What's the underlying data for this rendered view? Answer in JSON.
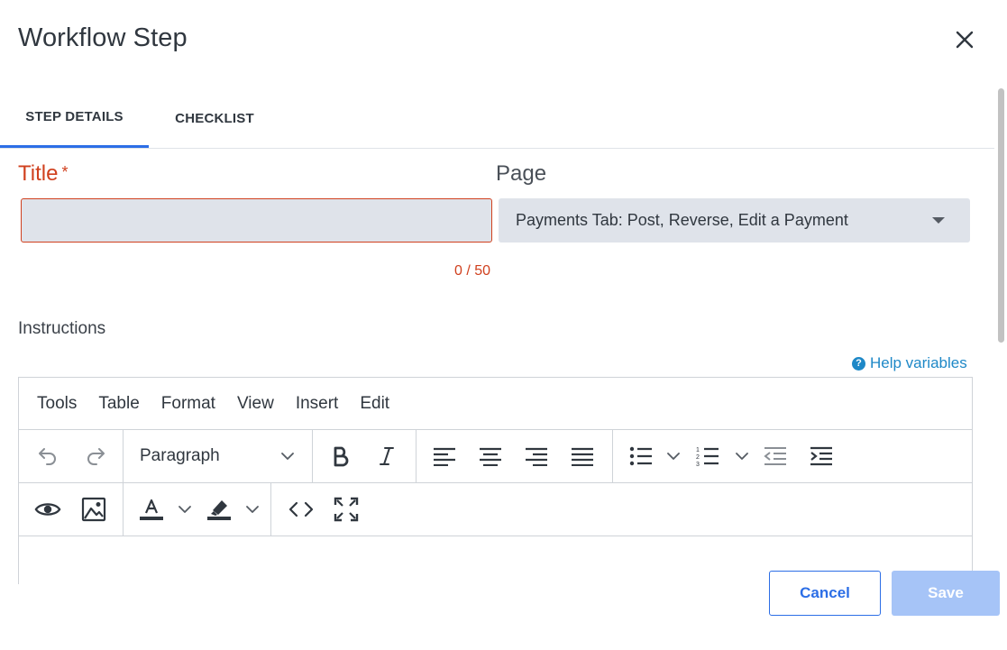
{
  "dialog": {
    "title": "Workflow Step",
    "close_icon": "close-icon"
  },
  "tabs": [
    {
      "label": "STEP DETAILS",
      "active": true
    },
    {
      "label": "CHECKLIST",
      "active": false
    }
  ],
  "form": {
    "title_label": "Title",
    "required_mark": "*",
    "title_value": "",
    "title_counter": "0 / 50",
    "page_label": "Page",
    "page_selected": "Payments Tab: Post, Reverse, Edit a Payment",
    "instructions_label": "Instructions",
    "help_link": "Help variables"
  },
  "editor": {
    "menu": [
      "Tools",
      "Table",
      "Format",
      "View",
      "Insert",
      "Edit"
    ],
    "block_format": "Paragraph",
    "toolbar_icons": [
      "undo-icon",
      "redo-icon",
      "bold-icon",
      "italic-icon",
      "align-left-icon",
      "align-center-icon",
      "align-right-icon",
      "align-justify-icon",
      "bullet-list-icon",
      "numbered-list-icon",
      "outdent-icon",
      "indent-icon",
      "preview-icon",
      "image-icon",
      "text-color-icon",
      "highlight-icon",
      "source-code-icon",
      "fullscreen-icon"
    ]
  },
  "footer": {
    "cancel_label": "Cancel",
    "save_label": "Save"
  },
  "colors": {
    "accent": "#2c6ee6",
    "error": "#d0401e",
    "link": "#1e88c7",
    "save_disabled": "#a6c4f7"
  }
}
